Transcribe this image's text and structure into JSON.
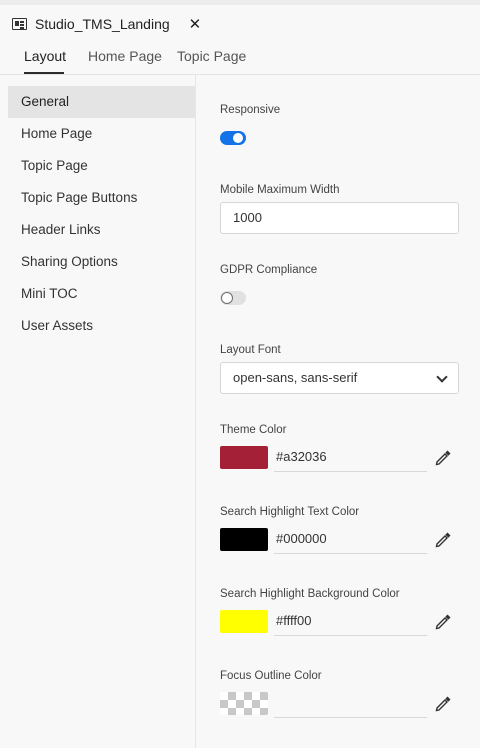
{
  "document_tab": {
    "title": "Studio_TMS_Landing",
    "close": "✕"
  },
  "subtabs": [
    "Layout",
    "Home Page",
    "Topic Page"
  ],
  "sidebar": {
    "items": [
      "General",
      "Home Page",
      "Topic Page",
      "Topic Page Buttons",
      "Header Links",
      "Sharing Options",
      "Mini TOC",
      "User Assets"
    ],
    "active": "General"
  },
  "settings": {
    "responsive": {
      "label": "Responsive",
      "enabled": true
    },
    "mobile_max_width": {
      "label": "Mobile Maximum Width",
      "value": "1000"
    },
    "gdpr": {
      "label": "GDPR Compliance",
      "enabled": false
    },
    "layout_font": {
      "label": "Layout Font",
      "value": "open-sans, sans-serif"
    },
    "theme_color": {
      "label": "Theme Color",
      "hex": "#a32036",
      "swatch": "#a32036"
    },
    "search_text_color": {
      "label": "Search Highlight Text Color",
      "hex": "#000000",
      "swatch": "#000000"
    },
    "search_bg_color": {
      "label": "Search Highlight Background Color",
      "hex": "#ffff00",
      "swatch": "#ffff00"
    },
    "focus_outline_color": {
      "label": "Focus Outline Color",
      "hex": ""
    }
  },
  "colors": {
    "accent": "#1473e6"
  }
}
